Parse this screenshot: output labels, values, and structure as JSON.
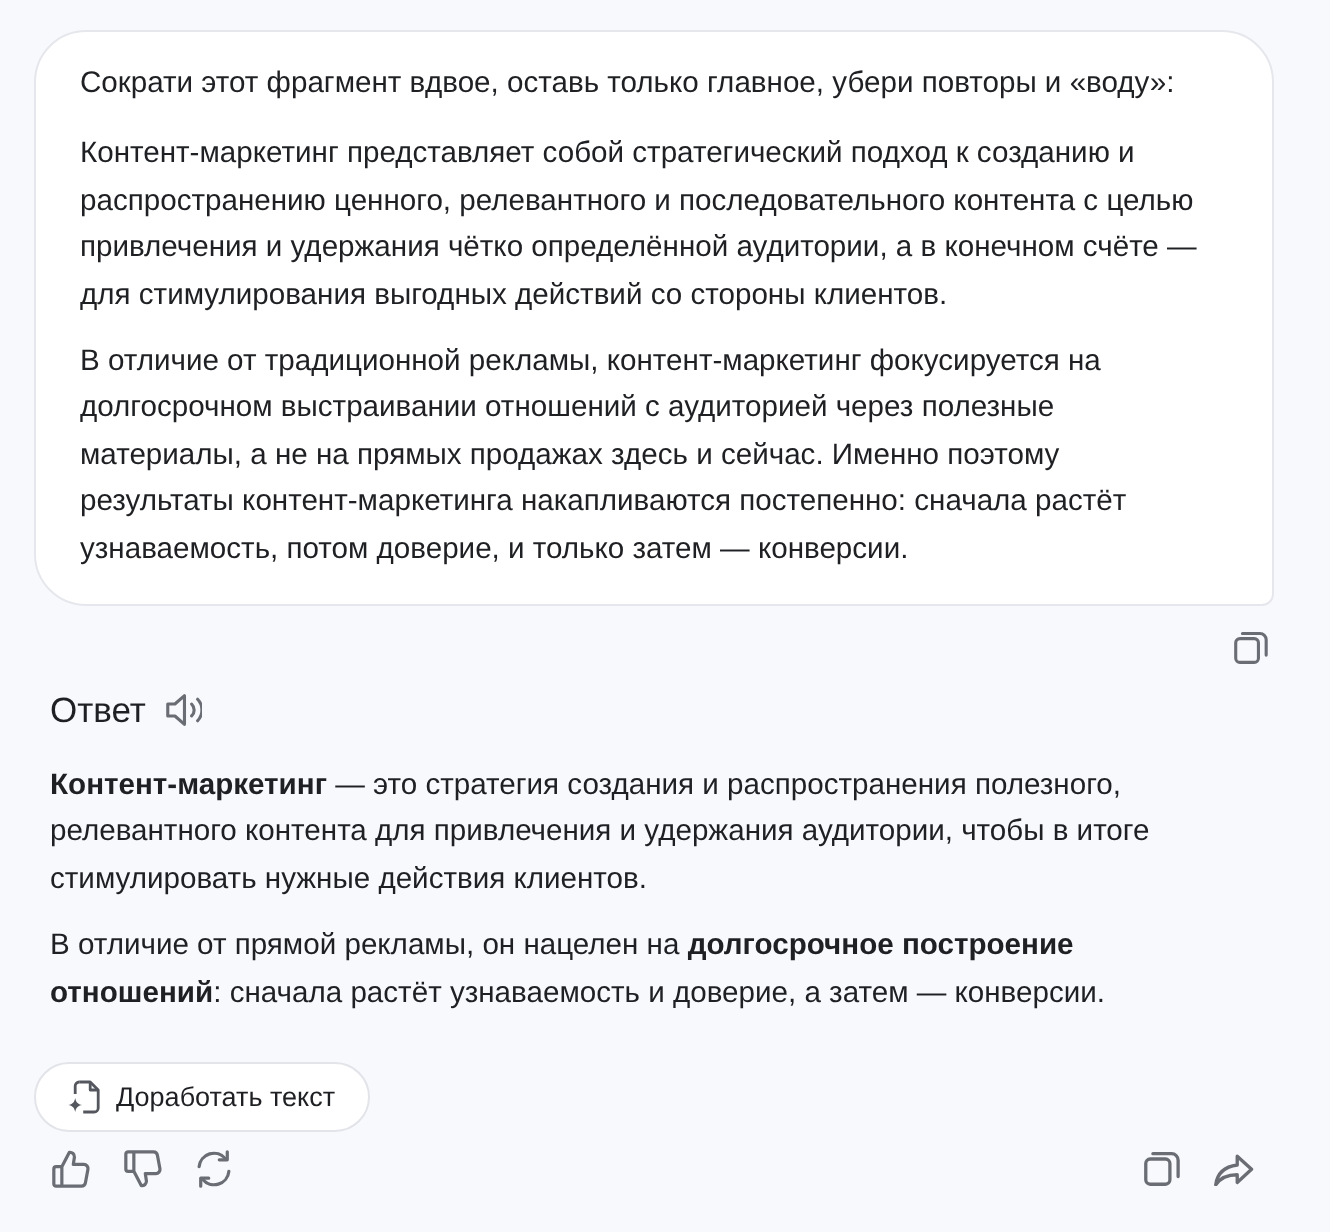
{
  "prompt": {
    "paragraphs": [
      "Сократи этот фрагмент вдвое, оставь только главное, убери повторы и «воду»:",
      "Контент-маркетинг представляет собой стратегический подход к созданию и распространению ценного, релевантного и последовательного контента с целью привлечения и удержания чётко определённой аудитории, а в конечном счёте — для стимулирования выгодных действий со стороны клиентов.",
      "В отличие от традиционной рекламы, контент-маркетинг фокусируется на долгосрочном выстраивании отношений с аудиторией через полезные материалы, а не на прямых продажах здесь и сейчас. Именно поэтому результаты контент-маркетинга накапливаются постепенно: сначала растёт узнаваемость, потом доверие, и только затем — конверсии."
    ]
  },
  "answer": {
    "title": "Ответ",
    "paragraphs": [
      "**Контент-маркетинг** — это стратегия создания и распространения полезного, релевантного контента для привлечения и удержания аудитории, чтобы в итоге стимулировать нужные действия клиентов.",
      "В отличие от прямой рекламы, он нацелен на **долгосрочное построение отношений**: сначала растёт узнаваемость и доверие, а затем — конверсии."
    ]
  },
  "improve_button": {
    "label": "Доработать текст"
  }
}
